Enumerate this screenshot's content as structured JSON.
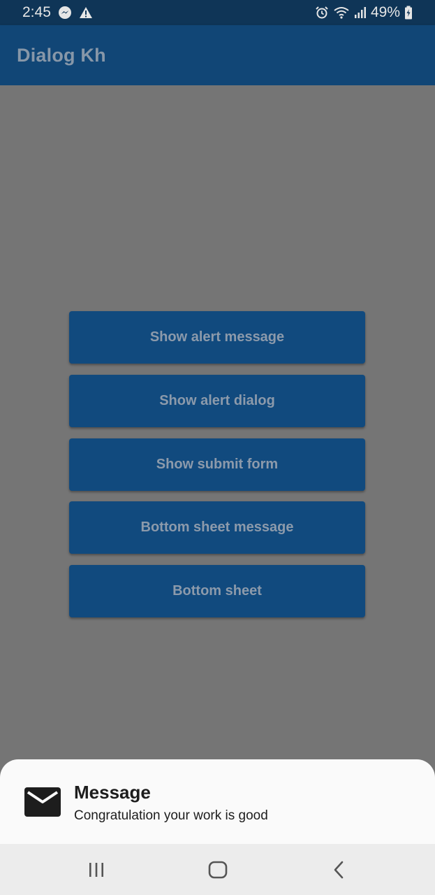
{
  "status_bar": {
    "time": "2:45",
    "battery": "49%",
    "left_icons": [
      "messenger-icon",
      "warning-icon"
    ],
    "right_icons": [
      "alarm-icon",
      "wifi-icon",
      "signal-icon",
      "battery-charging-icon"
    ]
  },
  "app_bar": {
    "title": "Dialog Kh"
  },
  "buttons": [
    {
      "label": "Show alert message"
    },
    {
      "label": "Show alert dialog"
    },
    {
      "label": "Show submit form"
    },
    {
      "label": "Bottom sheet message"
    },
    {
      "label": "Bottom sheet"
    }
  ],
  "bottom_sheet": {
    "icon": "mail-icon",
    "title": "Message",
    "subtitle": "Congratulation your work is good"
  },
  "nav_bar": {
    "icons": [
      "recent-apps-icon",
      "home-icon",
      "back-icon"
    ]
  },
  "colors": {
    "app_bar": "#114676",
    "button": "#114a7e",
    "scrim": "#757575",
    "sheet": "#fafafa"
  }
}
